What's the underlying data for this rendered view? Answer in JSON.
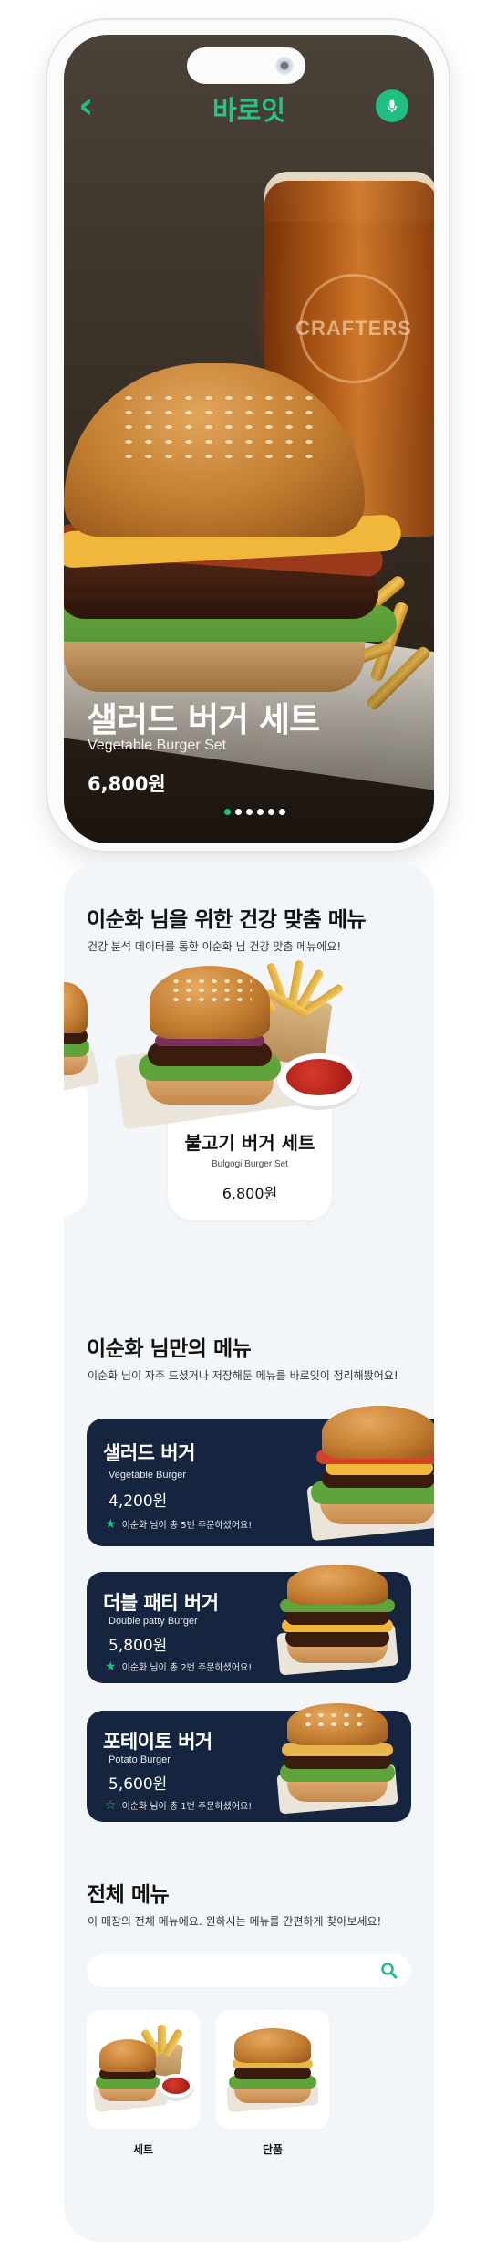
{
  "header": {
    "brand": "바로잇",
    "back_icon": "chevron-left-icon",
    "mic_icon": "microphone-icon",
    "accent_color": "#1fbf84"
  },
  "hero": {
    "title": "샐러드 버거 세트",
    "subtitle": "Vegetable Burger Set",
    "price": "6,800원",
    "glass_logo": "CRAFTERS",
    "slides_total": 6,
    "active_slide": 1
  },
  "recommend": {
    "title": "이순화 님을 위한 건강 맞춤 메뉴",
    "description": "건강 분석 데이터를 통한 이순화 님 건강 맞춤 메뉴에요!",
    "items": [
      {
        "name": "불고기 버거 세트",
        "subtitle": "Bulgogi Burger Set",
        "price": "6,800원"
      }
    ]
  },
  "my_menu": {
    "title": "이순화 님만의 메뉴",
    "description": "이순화 님이 자주 드셨거나 저장해둔 메뉴를 바로잇이 정리해봤어요!",
    "items": [
      {
        "name": "샐러드 버거",
        "subtitle": "Vegetable Burger",
        "price": "4,200원",
        "note": "이순화 님이 총 5번 주문하셨어요!",
        "starred": true
      },
      {
        "name": "더블 패티 버거",
        "subtitle": "Double patty Burger",
        "price": "5,800원",
        "note": "이순화 님이 총 2번 주문하셨어요!",
        "starred": true
      },
      {
        "name": "포테이토 버거",
        "subtitle": "Potato Burger",
        "price": "5,600원",
        "note": "이순화 님이 총 1번 주문하셨어요!",
        "starred": false
      }
    ]
  },
  "all_menu": {
    "title": "전체 메뉴",
    "description": "이 매장의 전체 메뉴에요. 원하시는 메뉴를 간편하게 찾아보세요!",
    "search_placeholder": "",
    "categories": [
      {
        "label": "세트"
      },
      {
        "label": "단품"
      }
    ]
  }
}
